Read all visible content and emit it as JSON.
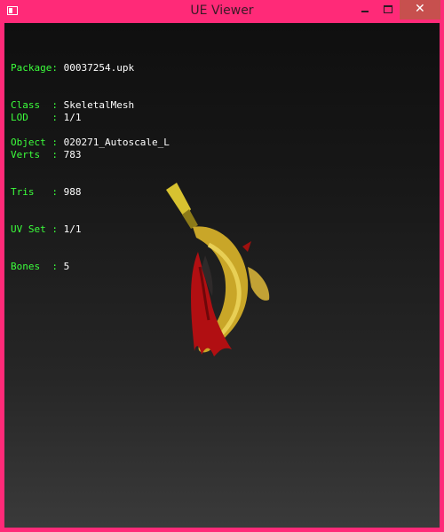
{
  "window": {
    "title": "UE Viewer"
  },
  "info": {
    "block1": [
      {
        "label": "Package: ",
        "value": "00037254.upk"
      },
      {
        "label": "Class  : ",
        "value": "SkeletalMesh"
      },
      {
        "label": "Object : ",
        "value": "020271_Autoscale_L"
      }
    ],
    "block2": [
      {
        "label": "LOD    : ",
        "value": "1/1"
      },
      {
        "label": "Verts  : ",
        "value": "783"
      },
      {
        "label": "Tris   : ",
        "value": "988"
      },
      {
        "label": "UV Set : ",
        "value": "1/1"
      },
      {
        "label": "Bones  : ",
        "value": "5"
      }
    ]
  },
  "colors": {
    "frame": "#ff2a78",
    "label_text": "#3cff3c",
    "value_text": "#ffffff",
    "close_button": "#c7504e",
    "mesh_yellow": "#c9a628",
    "mesh_red": "#b10f12"
  },
  "icons": {
    "app": "app-window-icon",
    "minimize": "minimize-icon",
    "maximize": "maximize-icon",
    "close": "close-icon"
  }
}
